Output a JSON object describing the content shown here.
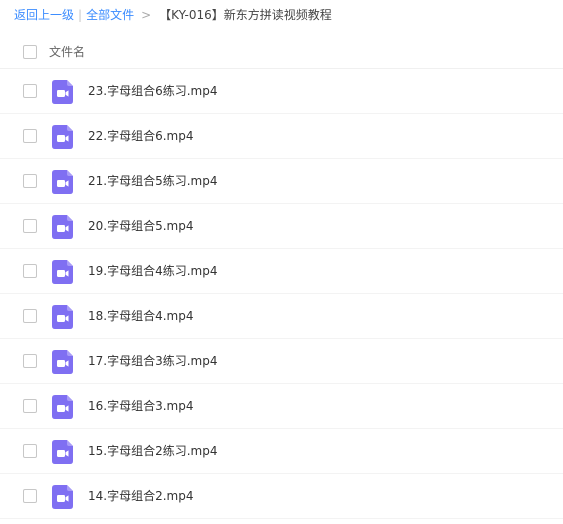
{
  "breadcrumb": {
    "back_label": "返回上一级",
    "separator": "|",
    "all_files_label": "全部文件",
    "arrow": ">",
    "current_folder": "【KY-016】新东方拼读视频教程"
  },
  "header": {
    "column_label": "文件名"
  },
  "colors": {
    "link": "#3b8cff",
    "video_icon": "#7f6ff2"
  },
  "files": [
    {
      "name": "23.字母组合6练习.mp4",
      "icon": "video-file-icon"
    },
    {
      "name": "22.字母组合6.mp4",
      "icon": "video-file-icon"
    },
    {
      "name": "21.字母组合5练习.mp4",
      "icon": "video-file-icon"
    },
    {
      "name": "20.字母组合5.mp4",
      "icon": "video-file-icon"
    },
    {
      "name": "19.字母组合4练习.mp4",
      "icon": "video-file-icon"
    },
    {
      "name": "18.字母组合4.mp4",
      "icon": "video-file-icon"
    },
    {
      "name": "17.字母组合3练习.mp4",
      "icon": "video-file-icon"
    },
    {
      "name": "16.字母组合3.mp4",
      "icon": "video-file-icon"
    },
    {
      "name": "15.字母组合2练习.mp4",
      "icon": "video-file-icon"
    },
    {
      "name": "14.字母组合2.mp4",
      "icon": "video-file-icon"
    }
  ]
}
